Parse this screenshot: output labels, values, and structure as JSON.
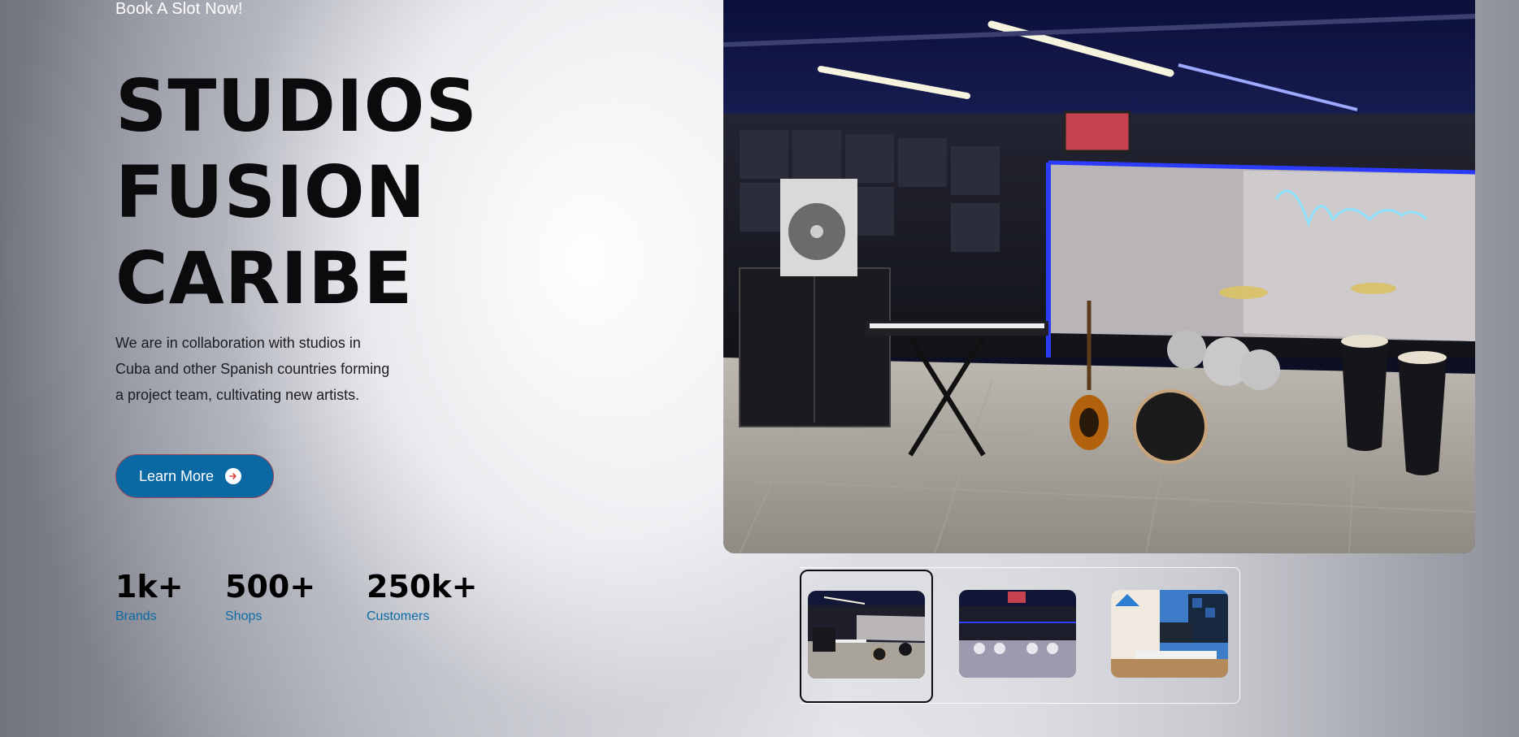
{
  "header": {
    "eyebrow": "Book A Slot Now!"
  },
  "hero": {
    "title_lines": [
      "STUDIOS",
      "FUSION",
      "CARIBE"
    ],
    "description_lines": [
      "We are in collaboration with studios in",
      "Cuba and other Spanish countries forming",
      "a project team, cultivating new artists."
    ],
    "cta_label": "Learn More",
    "cta_icon": "arrow-right-circle-icon"
  },
  "stats": [
    {
      "value": "1k+",
      "label": "Brands"
    },
    {
      "value": "500+",
      "label": "Shops"
    },
    {
      "value": "250k+",
      "label": "Customers"
    }
  ],
  "gallery": {
    "active_index": 0,
    "thumbnails": [
      "studio-room-thumbnail",
      "lounge-bar-thumbnail",
      "control-room-thumbnail"
    ]
  },
  "colors": {
    "accent": "#0a69a3",
    "label_blue": "#0c6aa5",
    "title": "#0b0b0d"
  }
}
